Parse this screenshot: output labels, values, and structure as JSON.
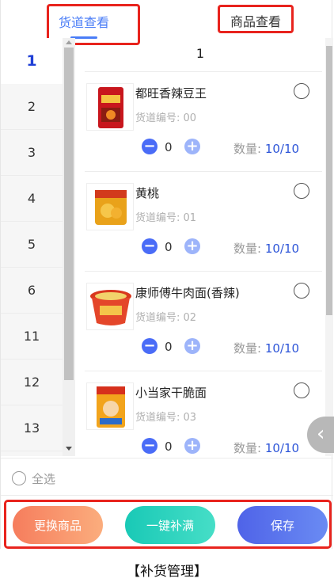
{
  "tabs": {
    "channel_view": "货道查看",
    "goods_view": "商品查看"
  },
  "lanes": [
    "1",
    "2",
    "3",
    "4",
    "5",
    "6",
    "11",
    "12",
    "13"
  ],
  "current_lane": "1",
  "items": [
    {
      "name": "都旺香辣豆王",
      "code": "货道编号: 00",
      "qty": "0",
      "count_label": "数量:",
      "count_value": "10/10",
      "image": "spicy-bean-snack-image"
    },
    {
      "name": "黄桃",
      "code": "货道编号: 01",
      "qty": "0",
      "count_label": "数量:",
      "count_value": "10/10",
      "image": "yellow-peach-snack-image"
    },
    {
      "name": "康师傅牛肉面(香辣)",
      "code": "货道编号: 02",
      "qty": "0",
      "count_label": "数量:",
      "count_value": "10/10",
      "image": "instant-noodle-bowl-image"
    },
    {
      "name": "小当家干脆面",
      "code": "货道编号: 03",
      "qty": "0",
      "count_label": "数量:",
      "count_value": "10/10",
      "image": "crispy-noodle-snack-image"
    }
  ],
  "select_all": "全选",
  "actions": {
    "change_goods": "更换商品",
    "fill_all": "一键补满",
    "save": "保存"
  },
  "caption": "【补货管理】",
  "colors": {
    "accent": "#4a7df7",
    "highlight_box": "#e8231d",
    "change": "#f67d5d",
    "fill": "#19c9b6",
    "save": "#4f63e8"
  }
}
